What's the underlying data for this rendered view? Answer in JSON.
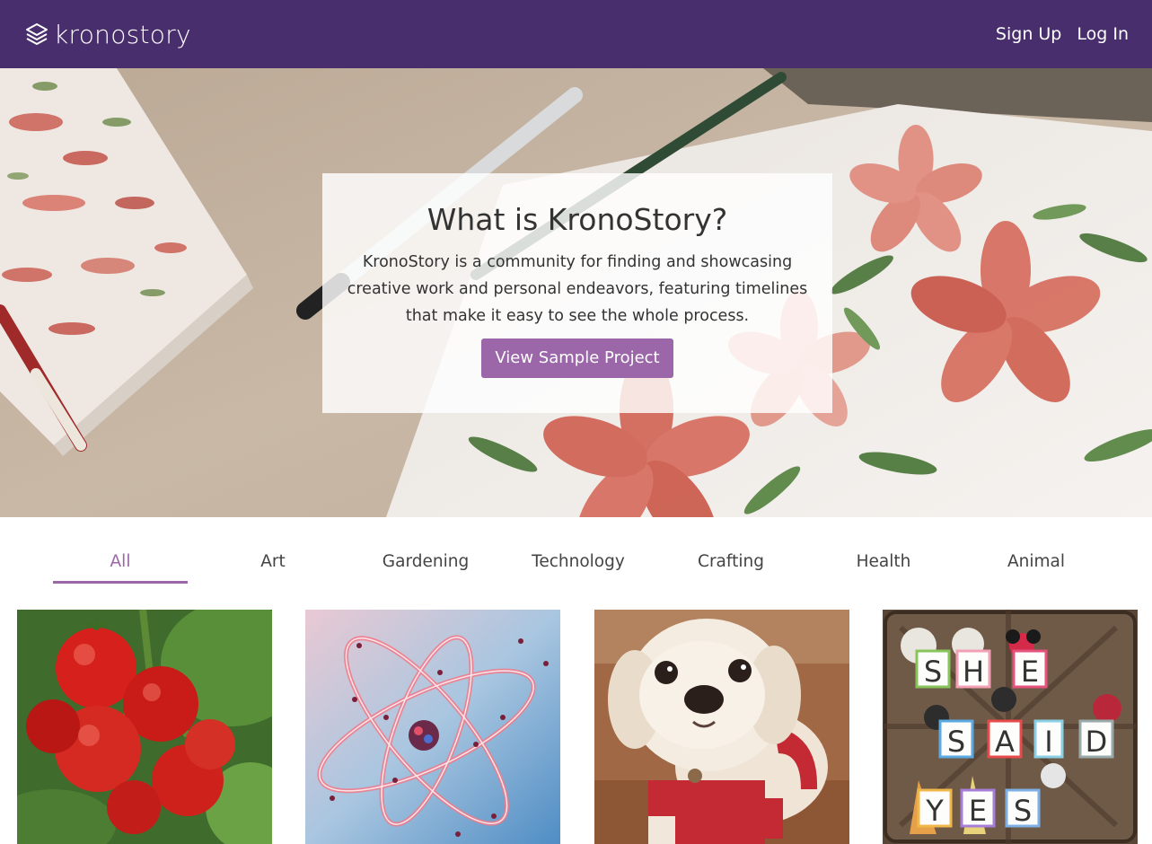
{
  "brand": {
    "name": "kronostory"
  },
  "nav": {
    "signup": "Sign Up",
    "login": "Log In"
  },
  "hero": {
    "title": "What is KronoStory?",
    "description": "KronoStory is a community for finding and showcasing creative work and personal endeavors, featuring timelines that make it easy to see the whole process.",
    "button": "View Sample Project"
  },
  "tabs": [
    {
      "label": "All",
      "active": true
    },
    {
      "label": "Art",
      "active": false
    },
    {
      "label": "Gardening",
      "active": false
    },
    {
      "label": "Technology",
      "active": false
    },
    {
      "label": "Crafting",
      "active": false
    },
    {
      "label": "Health",
      "active": false
    },
    {
      "label": "Animal",
      "active": false
    }
  ],
  "cards": [
    {
      "subject": "tomatoes"
    },
    {
      "subject": "atom"
    },
    {
      "subject": "dog"
    },
    {
      "subject": "she-said-yes-letters",
      "letters": [
        "S",
        "H",
        "E",
        "S",
        "A",
        "I",
        "D",
        "Y",
        "E",
        "S"
      ]
    }
  ],
  "colors": {
    "navbar": "#482e6d",
    "accent": "#9b67a9"
  }
}
